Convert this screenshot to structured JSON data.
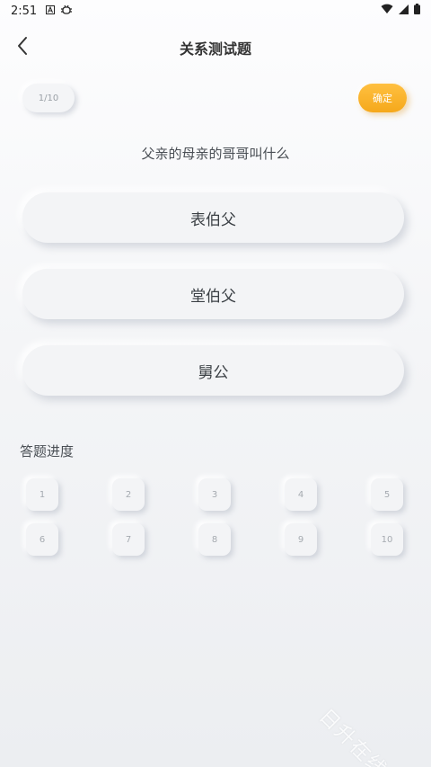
{
  "status_bar": {
    "time": "2:51",
    "left_icons": [
      "font-A-icon",
      "bug-icon"
    ],
    "right_icons": [
      "wifi-icon",
      "signal-icon",
      "battery-icon"
    ]
  },
  "header": {
    "title": "关系测试题",
    "back_icon": "chevron-left-icon"
  },
  "quiz": {
    "progress": "1/10",
    "confirm_label": "确定",
    "question": "父亲的母亲的哥哥叫什么",
    "options": [
      "表伯父",
      "堂伯父",
      "舅公"
    ]
  },
  "answer_progress": {
    "label": "答题进度",
    "items": [
      "1",
      "2",
      "3",
      "4",
      "5",
      "6",
      "7",
      "8",
      "9",
      "10"
    ]
  },
  "watermark": "日升在线",
  "colors": {
    "accent": "#f7ad22",
    "background": "#f3f4f6",
    "text": "#3b4045"
  }
}
